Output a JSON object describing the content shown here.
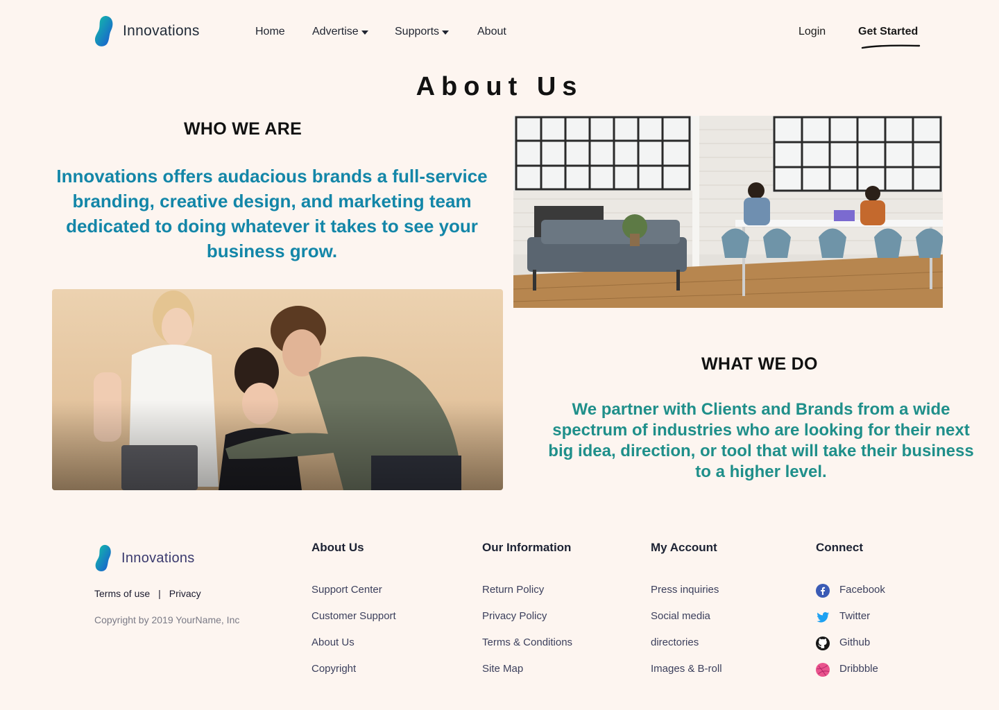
{
  "brand": {
    "name": "Innovations",
    "color_top": "#10b6a9",
    "color_bottom": "#1a5fcf"
  },
  "nav": {
    "items": [
      {
        "label": "Home",
        "dropdown": false
      },
      {
        "label": "Advertise",
        "dropdown": true
      },
      {
        "label": "Supports",
        "dropdown": true
      },
      {
        "label": "About",
        "dropdown": false
      }
    ],
    "login_label": "Login",
    "cta_label": "Get Started"
  },
  "page_title": "About Us",
  "who": {
    "heading": "WHO WE ARE",
    "text": "Innovations offers audacious brands a full-service branding, creative design, and marketing team dedicated to doing whatever it takes to see your business grow.",
    "text_color": "#1386a8"
  },
  "what": {
    "heading": "WHAT WE DO",
    "text": "We partner with Clients and Brands from a wide spectrum of industries who are looking for their next big idea, direction, or tool that will take their business to a higher level.",
    "text_color": "#1f8f8a"
  },
  "footer": {
    "legal": {
      "terms": "Terms of use",
      "separator": "|",
      "privacy": "Privacy"
    },
    "copyright": "Copyright by 2019 YourName, Inc",
    "columns": [
      {
        "heading": "About Us",
        "links": [
          "Support Center",
          "Customer Support",
          "About Us",
          "Copyright"
        ]
      },
      {
        "heading": "Our Information",
        "links": [
          "Return Policy",
          "Privacy Policy",
          "Terms & Conditions",
          "Site Map"
        ]
      },
      {
        "heading": "My Account",
        "links": [
          "Press inquiries",
          "Social media",
          "directories",
          "Images & B-roll"
        ]
      }
    ],
    "connect": {
      "heading": "Connect",
      "links": [
        {
          "label": "Facebook",
          "icon": "facebook-icon"
        },
        {
          "label": "Twitter",
          "icon": "twitter-icon"
        },
        {
          "label": "Github",
          "icon": "github-icon"
        },
        {
          "label": "Dribbble",
          "icon": "dribbble-icon"
        }
      ]
    }
  }
}
